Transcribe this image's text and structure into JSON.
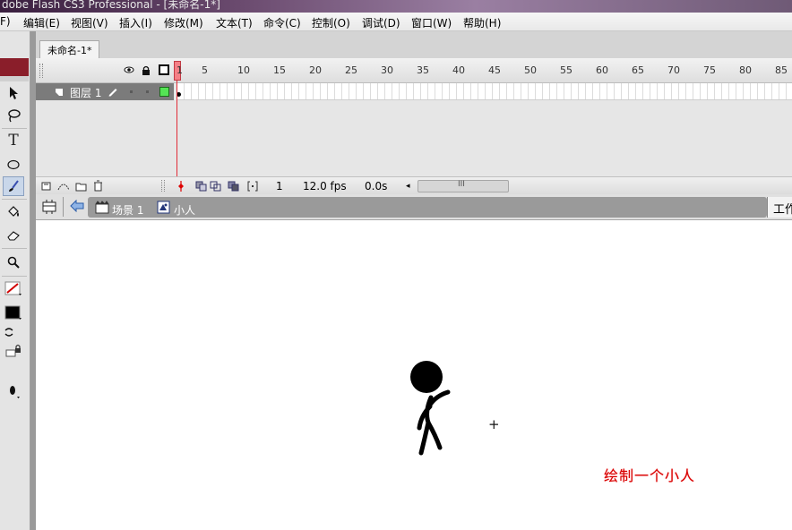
{
  "window": {
    "title": "dobe Flash CS3 Professional - [未命名-1*]"
  },
  "menu": [
    "F)",
    "编辑(E)",
    "视图(V)",
    "插入(I)",
    "修改(M)",
    "文本(T)",
    "命令(C)",
    "控制(O)",
    "调试(D)",
    "窗口(W)",
    "帮助(H)"
  ],
  "document_tab": "未命名-1*",
  "timeline": {
    "frame_numbers": [
      "1",
      "5",
      "10",
      "15",
      "20",
      "25",
      "30",
      "35",
      "40",
      "45",
      "50",
      "55",
      "60",
      "65",
      "70",
      "75",
      "80",
      "85"
    ],
    "layer_name": "图层 1",
    "current_frame": "1",
    "frame_rate": "12.0 fps",
    "elapsed_time": "0.0s",
    "scroll_grip": "III"
  },
  "edit_bar": {
    "scene": "场景 1",
    "symbol": "小人",
    "workspace": "工作"
  },
  "stage": {
    "caption": "绘制一个小人"
  },
  "icons": {
    "eye": "eye-icon",
    "lock": "lock-icon",
    "outline": "outline-square-icon",
    "selection": "arrow-icon",
    "lasso": "lasso-icon",
    "text": "T",
    "oval": "oval-icon",
    "brush": "brush-icon",
    "paint-bucket": "bucket-icon",
    "eraser": "eraser-icon",
    "zoom": "magnifier-icon",
    "stroke-color": "pencil-stroke-icon",
    "fill-color": "fill-swatch-icon",
    "swap": "swap-icon",
    "lock-fill": "lock-fill-icon",
    "brush-shape": "brush-shape-icon"
  },
  "colors": {
    "accent_red": "#8a1e2a",
    "playhead": "#e02b37",
    "caption": "#d60000",
    "layer_box": "#55e455"
  }
}
